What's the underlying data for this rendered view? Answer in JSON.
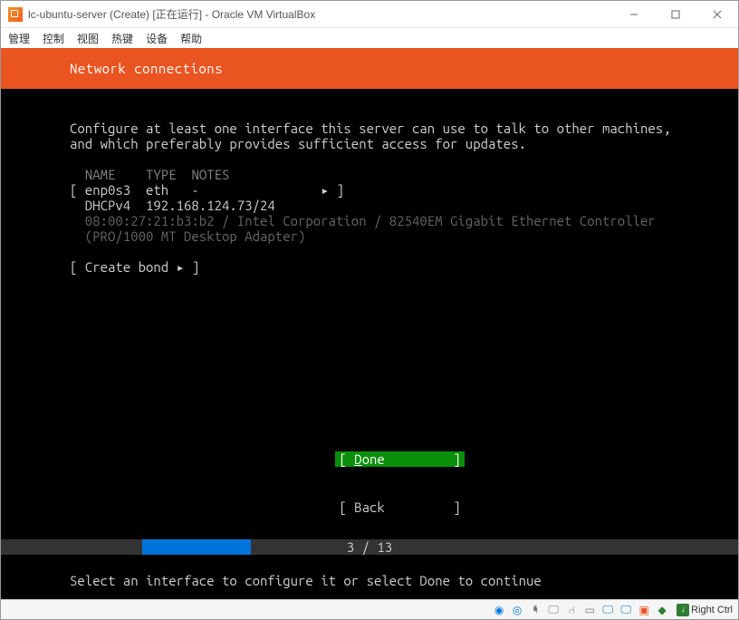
{
  "window": {
    "title": "lc-ubuntu-server (Create) [正在运行] - Oracle VM VirtualBox"
  },
  "menubar": {
    "items": [
      "管理",
      "控制",
      "视图",
      "热键",
      "设备",
      "帮助"
    ]
  },
  "installer": {
    "header": "Network connections",
    "intro_line1": "Configure at least one interface this server can use to talk to other machines,",
    "intro_line2": "and which preferably provides sufficient access for updates.",
    "columns": {
      "name": "NAME",
      "type": "TYPE",
      "notes": "NOTES"
    },
    "iface_row": "[ enp0s3  eth   -                ▸ ]",
    "dhcp_row": "  DHCPv4  192.168.124.73/24",
    "hw_line1": "  08:00:27:21:b3:b2 / Intel Corporation / 82540EM Gigabit Ethernet Controller",
    "hw_line2": "  (PRO/1000 MT Desktop Adapter)",
    "create_bond": "[ Create bond ▸ ]",
    "done_label": "[ Done         ]",
    "back_label": "[ Back         ]",
    "progress_text": "3 / 13",
    "hint": "Select an interface to configure it or select Done to continue"
  },
  "statusbar": {
    "hostkey": "Right Ctrl"
  }
}
